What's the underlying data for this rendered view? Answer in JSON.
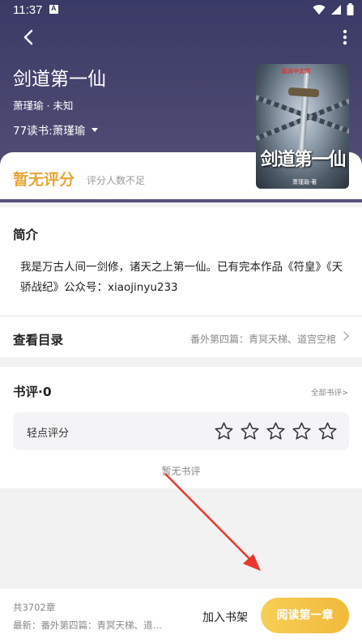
{
  "status_bar": {
    "time": "11:37"
  },
  "book": {
    "title": "剑道第一仙",
    "author_line": "萧瑾瑜 · 未知",
    "reader_line": "77读书:萧瑾瑜",
    "cover": {
      "title": "剑道第一仙",
      "publisher": "起点中文网",
      "author": "萧瑾瑜·著"
    }
  },
  "rating": {
    "headline": "暂无评分",
    "note": "评分人数不足"
  },
  "intro": {
    "title": "简介",
    "text": "我是万古人间一剑修，诸天之上第一仙。已有完本作品《符皇》《天骄战纪》公众号：xiaojinyu233"
  },
  "catalog": {
    "title": "查看目录",
    "latest": "番外第四篇：青冥天梯、道宫空棺"
  },
  "reviews": {
    "title": "书评·0",
    "all_link": "全部书评>",
    "rate_label": "轻点评分",
    "stars": 0,
    "empty": "暂无书评"
  },
  "bottom": {
    "chapter_count": "共3702章",
    "newest": "最新：番外第四篇：青冥天梯、道…",
    "shelf_button": "加入书架",
    "read_button": "阅读第一章"
  },
  "colors": {
    "accent": "#e8a535",
    "header": "#3a3a66",
    "read_button": "#f3c145",
    "arrow": "#e8382e"
  }
}
